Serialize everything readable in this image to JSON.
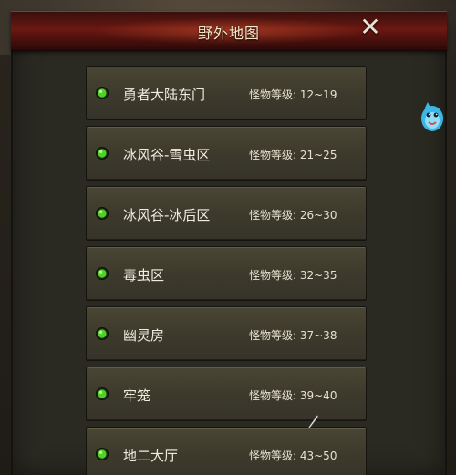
{
  "window": {
    "title": "野外地图",
    "close_icon": "close-icon"
  },
  "colors": {
    "title_bar": "#6a1812",
    "row_bg": "#3d3a2c",
    "gem": "#4fd12a",
    "text": "#f1ece0"
  },
  "maps": [
    {
      "name": "勇者大陆东门",
      "level": "怪物等级: 12~19"
    },
    {
      "name": "冰风谷-雪虫区",
      "level": "怪物等级: 21~25"
    },
    {
      "name": "冰风谷-冰后区",
      "level": "怪物等级: 26~30"
    },
    {
      "name": "毒虫区",
      "level": "怪物等级: 32~35"
    },
    {
      "name": "幽灵房",
      "level": "怪物等级: 37~38"
    },
    {
      "name": "牢笼",
      "level": "怪物等级: 39~40"
    },
    {
      "name": "地二大厅",
      "level": "怪物等级: 43~50"
    }
  ],
  "decor": {
    "mascot_icon": "blue-creature-icon",
    "cursor_icon": "pointer-cursor-icon"
  }
}
